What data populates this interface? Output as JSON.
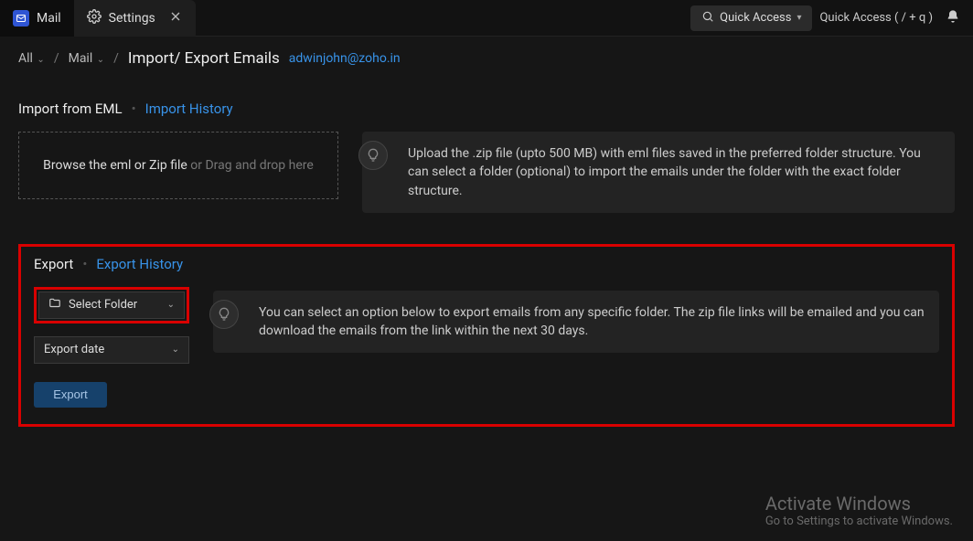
{
  "tabs": {
    "mail_label": "Mail",
    "settings_label": "Settings"
  },
  "topbar": {
    "quick_access_button": "Quick Access",
    "quick_access_hint": "Quick Access  ( / + q )"
  },
  "breadcrumb": {
    "all": "All",
    "mail": "Mail",
    "title": "Import/ Export Emails",
    "email": "adwinjohn@zoho.in"
  },
  "import": {
    "label": "Import from EML",
    "history_link": "Import History",
    "drop_strong": "Browse the eml or Zip file",
    "drop_rest": " or Drag and drop here",
    "hint": "Upload the .zip file (upto 500 MB) with eml files saved in the preferred folder structure. You can select a folder (optional) to import the emails under the folder with the exact folder structure."
  },
  "export": {
    "label": "Export",
    "history_link": "Export History",
    "select_folder": "Select Folder",
    "export_date": "Export date",
    "hint": "You can select an option below to export emails from any specific folder. The zip file links will be emailed and you can download the emails from the link within the next 30 days.",
    "button": "Export"
  },
  "watermark": {
    "line1": "Activate Windows",
    "line2": "Go to Settings to activate Windows."
  }
}
